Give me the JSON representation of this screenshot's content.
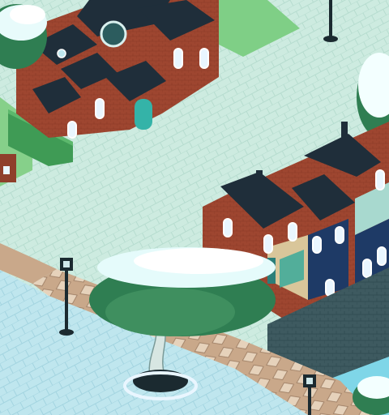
{
  "scene": {
    "type": "isometric-town",
    "palette": {
      "street": "#cdebe0",
      "street_line": "#b4dbcf",
      "plaza": "#bfe6ee",
      "plaza_line": "#9fd3e0",
      "grass": "#8ed28c",
      "hedge": "#4aa55c",
      "brick": "#a24a32",
      "brick_dark": "#7e3522",
      "roof": "#1f2e3a",
      "window": "#e9f6ff",
      "window_frame": "#ffffff",
      "foliage": "#2f7e52",
      "foliage_light": "#4fa56a",
      "snow": "#ffffff",
      "water": "#7fd6e8",
      "canal_wall": "#36535a",
      "lamp": "#1b2a30"
    },
    "icons": [
      "church",
      "townhouse-row",
      "street-lamp",
      "snowy-tree",
      "hedge",
      "canal"
    ]
  }
}
